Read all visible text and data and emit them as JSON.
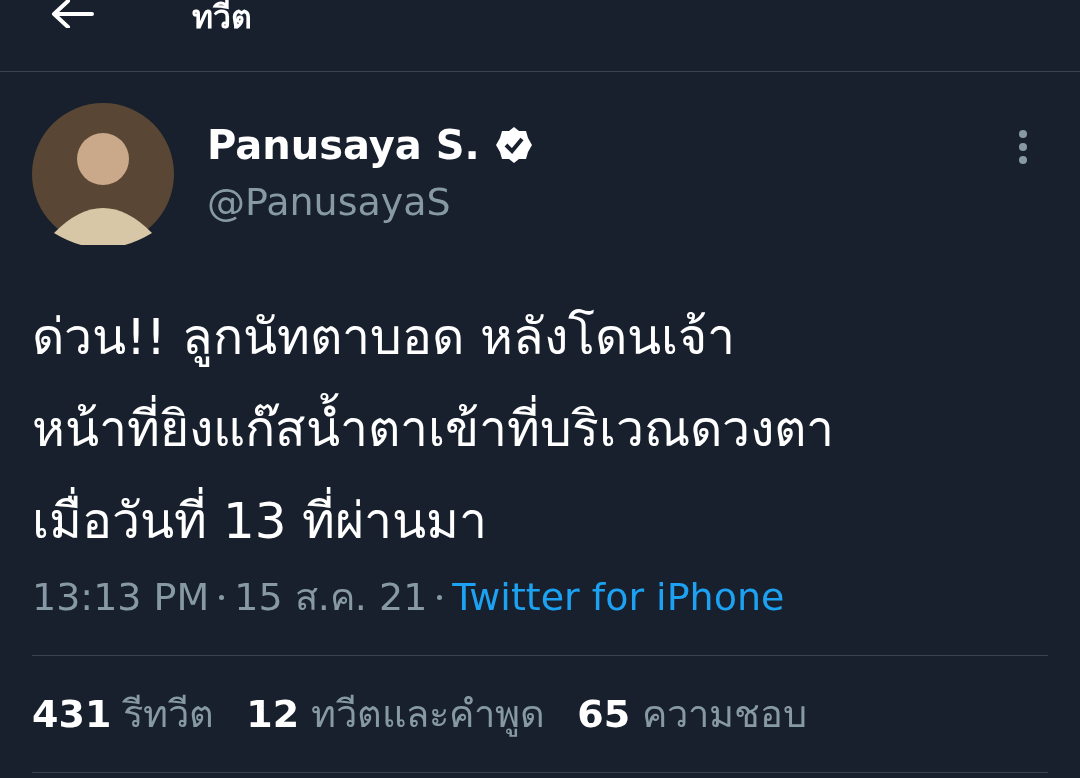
{
  "header": {
    "title": "ทวีต"
  },
  "author": {
    "name": "Panusaya S.",
    "handle": "@PanusayaS",
    "verified": true
  },
  "tweet": {
    "lines": [
      "ด่วน!! ลูกนัทตาบอด หลังโดนเจ้า",
      "หน้าที่ยิงแก๊สน้ำตาเข้าที่บริเวณดวงตา",
      "เมื่อวันที่ 13 ที่ผ่านมา"
    ],
    "time": "13:13 PM",
    "date": "15 ส.ค. 21",
    "source": "Twitter for iPhone"
  },
  "stats": [
    {
      "count": "431",
      "label": "รีทวีต"
    },
    {
      "count": "12",
      "label": "ทวีตและคำพูด"
    },
    {
      "count": "65",
      "label": "ความชอบ"
    }
  ]
}
